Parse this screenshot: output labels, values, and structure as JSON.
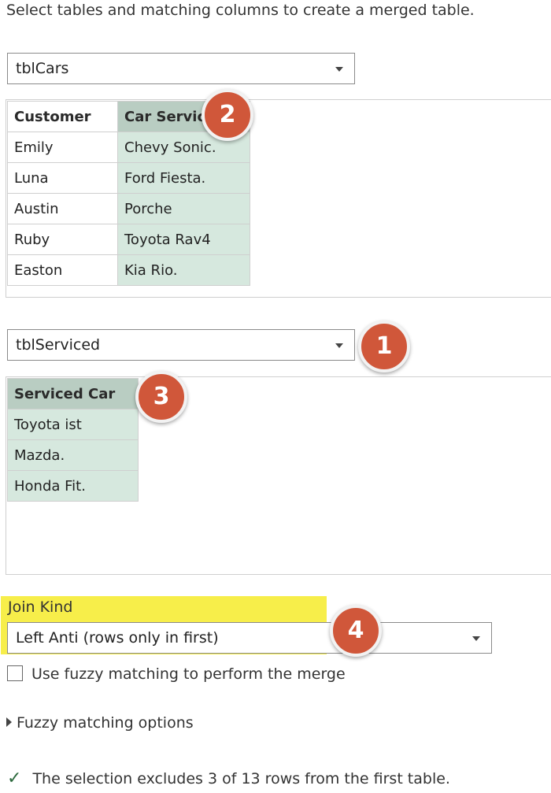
{
  "instruction": "Select tables and matching columns to create a merged table.",
  "first_table": {
    "selected": "tblCars",
    "headers": [
      "Customer",
      "Car Servic"
    ],
    "rows": [
      [
        "Emily",
        "Chevy Sonic."
      ],
      [
        "Luna",
        "Ford Fiesta."
      ],
      [
        "Austin",
        "Porche"
      ],
      [
        "Ruby",
        "Toyota Rav4"
      ],
      [
        "Easton",
        "Kia Rio."
      ]
    ]
  },
  "second_table": {
    "selected": "tblServiced",
    "headers": [
      "Serviced Car"
    ],
    "rows": [
      [
        "Toyota ist"
      ],
      [
        "Mazda."
      ],
      [
        "Honda Fit."
      ]
    ]
  },
  "join_kind": {
    "label": "Join Kind",
    "selected": "Left Anti (rows only in first)"
  },
  "fuzzy": {
    "checkbox_label": "Use fuzzy matching to perform the merge",
    "checked": false,
    "options_label": "Fuzzy matching options"
  },
  "status_text": "The selection excludes 3 of 13 rows from the first table.",
  "badges": [
    "1",
    "2",
    "3",
    "4"
  ],
  "colors": {
    "badge": "#d0573a",
    "highlight": "#f7ee4a",
    "selected_column": "#d6e8de",
    "selected_header": "#b9cdc2"
  }
}
